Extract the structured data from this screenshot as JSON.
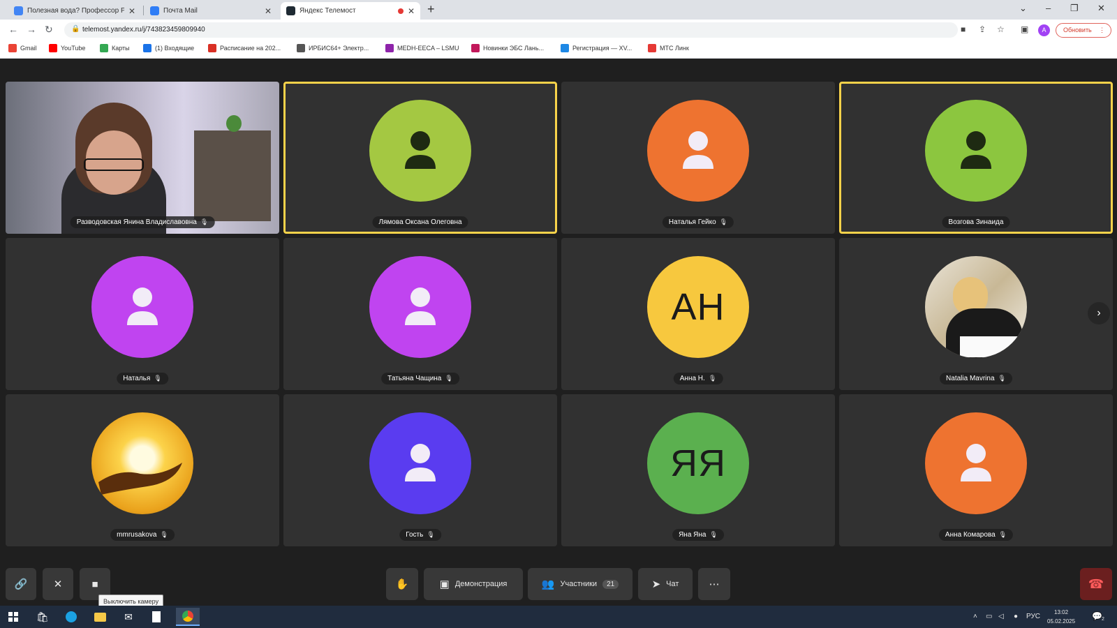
{
  "browser": {
    "tabs": [
      {
        "title": "Полезная вода? Профессор Ро",
        "favicon_color": "#4285f4"
      },
      {
        "title": "Почта Mail",
        "favicon_color": "#2f7df6"
      },
      {
        "title": "Яндекс Телемост",
        "favicon_color": "#1f2a33"
      }
    ],
    "address_url": "telemost.yandex.ru/j/743823459809940",
    "update_button": "Обновить",
    "profile_initial": "A",
    "bookmarks": [
      {
        "label": "Gmail",
        "icon_color": "#ea4335"
      },
      {
        "label": "YouTube",
        "icon_color": "#ff0000"
      },
      {
        "label": "Карты",
        "icon_color": "#34a853"
      },
      {
        "label": "(1) Входящие",
        "icon_color": "#1a73e8"
      },
      {
        "label": "Расписание на 202...",
        "icon_color": "#d93025"
      },
      {
        "label": "ИРБИС64+ Электр...",
        "icon_color": "#555555"
      },
      {
        "label": "MEDH-EECA – LSMU",
        "icon_color": "#8e24aa"
      },
      {
        "label": "Новинки ЭБС Лань...",
        "icon_color": "#c2185b"
      },
      {
        "label": "Регистрация — XV...",
        "icon_color": "#1e88e5"
      },
      {
        "label": "МТС Линк",
        "icon_color": "#e53935"
      }
    ]
  },
  "participants": [
    {
      "name": "Разводовская Янина Владиславовна",
      "kind": "video",
      "speaking": false,
      "mic_off": true
    },
    {
      "name": "Лямова Оксана Олеговна",
      "kind": "icon",
      "color": "#a4c842",
      "speaking": true,
      "mic_off": false
    },
    {
      "name": "Наталья Гейко",
      "kind": "icon",
      "color": "#ee7330",
      "speaking": false,
      "mic_off": true
    },
    {
      "name": "Возгова Зинаида",
      "kind": "icon",
      "color": "#8cc63f",
      "speaking": true,
      "mic_off": false
    },
    {
      "name": "Наталья",
      "kind": "icon",
      "color": "#c044f0",
      "speaking": false,
      "mic_off": true
    },
    {
      "name": "Татьяна Чащина",
      "kind": "icon",
      "color": "#c044f0",
      "speaking": false,
      "mic_off": true
    },
    {
      "name": "Анна Н.",
      "kind": "initials",
      "initials": "АН",
      "color": "#f7c83e",
      "speaking": false,
      "mic_off": true
    },
    {
      "name": "Natalia Mavrina",
      "kind": "photo",
      "speaking": false,
      "mic_off": true
    },
    {
      "name": "mmrusakova",
      "kind": "sunset",
      "speaking": false,
      "mic_off": true
    },
    {
      "name": "Гость",
      "kind": "icon",
      "color": "#5a3cf0",
      "speaking": false,
      "mic_off": true
    },
    {
      "name": "Яна Яна",
      "kind": "initials",
      "initials": "ЯЯ",
      "color": "#5bb04f",
      "speaking": false,
      "mic_off": true
    },
    {
      "name": "Анна Комарова",
      "kind": "icon",
      "color": "#ee7330",
      "speaking": false,
      "mic_off": true
    }
  ],
  "controls": {
    "screen_share": "Демонстрация",
    "participants_label": "Участники",
    "participants_count": "21",
    "chat": "Чат",
    "camera_tooltip": "Выключить камеру"
  },
  "taskbar": {
    "lang": "РУС",
    "time": "13:02",
    "date": "05.02.2025",
    "notification_count": "2"
  }
}
